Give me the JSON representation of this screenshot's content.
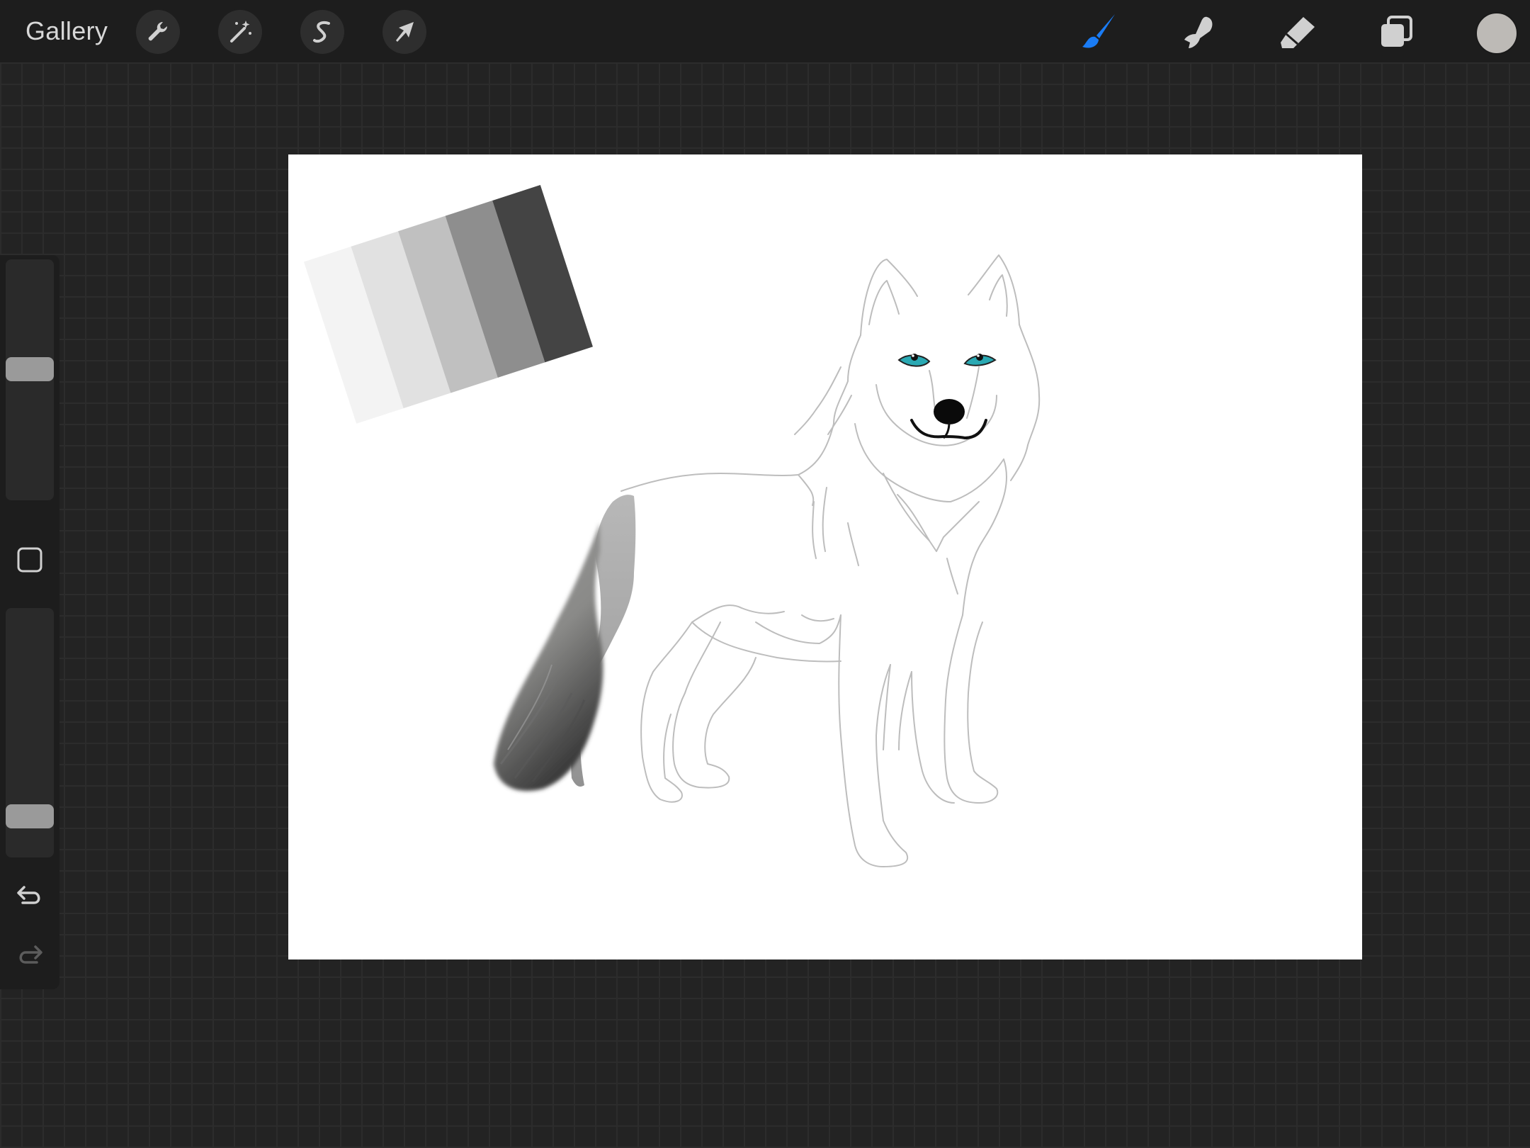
{
  "topbar": {
    "gallery_label": "Gallery",
    "left_tools": [
      {
        "name": "actions",
        "icon": "wrench-icon"
      },
      {
        "name": "adjustments",
        "icon": "magic-wand-icon"
      },
      {
        "name": "selection",
        "icon": "selection-s-icon"
      },
      {
        "name": "transform",
        "icon": "arrow-cursor-icon"
      }
    ],
    "right_tools": [
      {
        "name": "brush",
        "icon": "brush-icon",
        "active": true
      },
      {
        "name": "smudge",
        "icon": "smudge-finger-icon",
        "active": false
      },
      {
        "name": "eraser",
        "icon": "eraser-icon",
        "active": false
      },
      {
        "name": "layers",
        "icon": "layers-icon",
        "active": false
      }
    ],
    "current_color": "#bdbab6",
    "active_color": "#1a7cf5",
    "inactive_color": "#d0d0d0"
  },
  "sidebar": {
    "brush_size_level": 0.55,
    "opacity_level": 0.13,
    "icons": [
      "modify-square-icon",
      "undo-icon",
      "redo-icon"
    ]
  },
  "canvas": {
    "background": "#ffffff",
    "grayscale_swatches": [
      "#f3f3f3",
      "#e1e1e1",
      "#c0c0c0",
      "#8e8e8e",
      "#444444"
    ],
    "wolf_eye_color": "#2aa9b3"
  }
}
